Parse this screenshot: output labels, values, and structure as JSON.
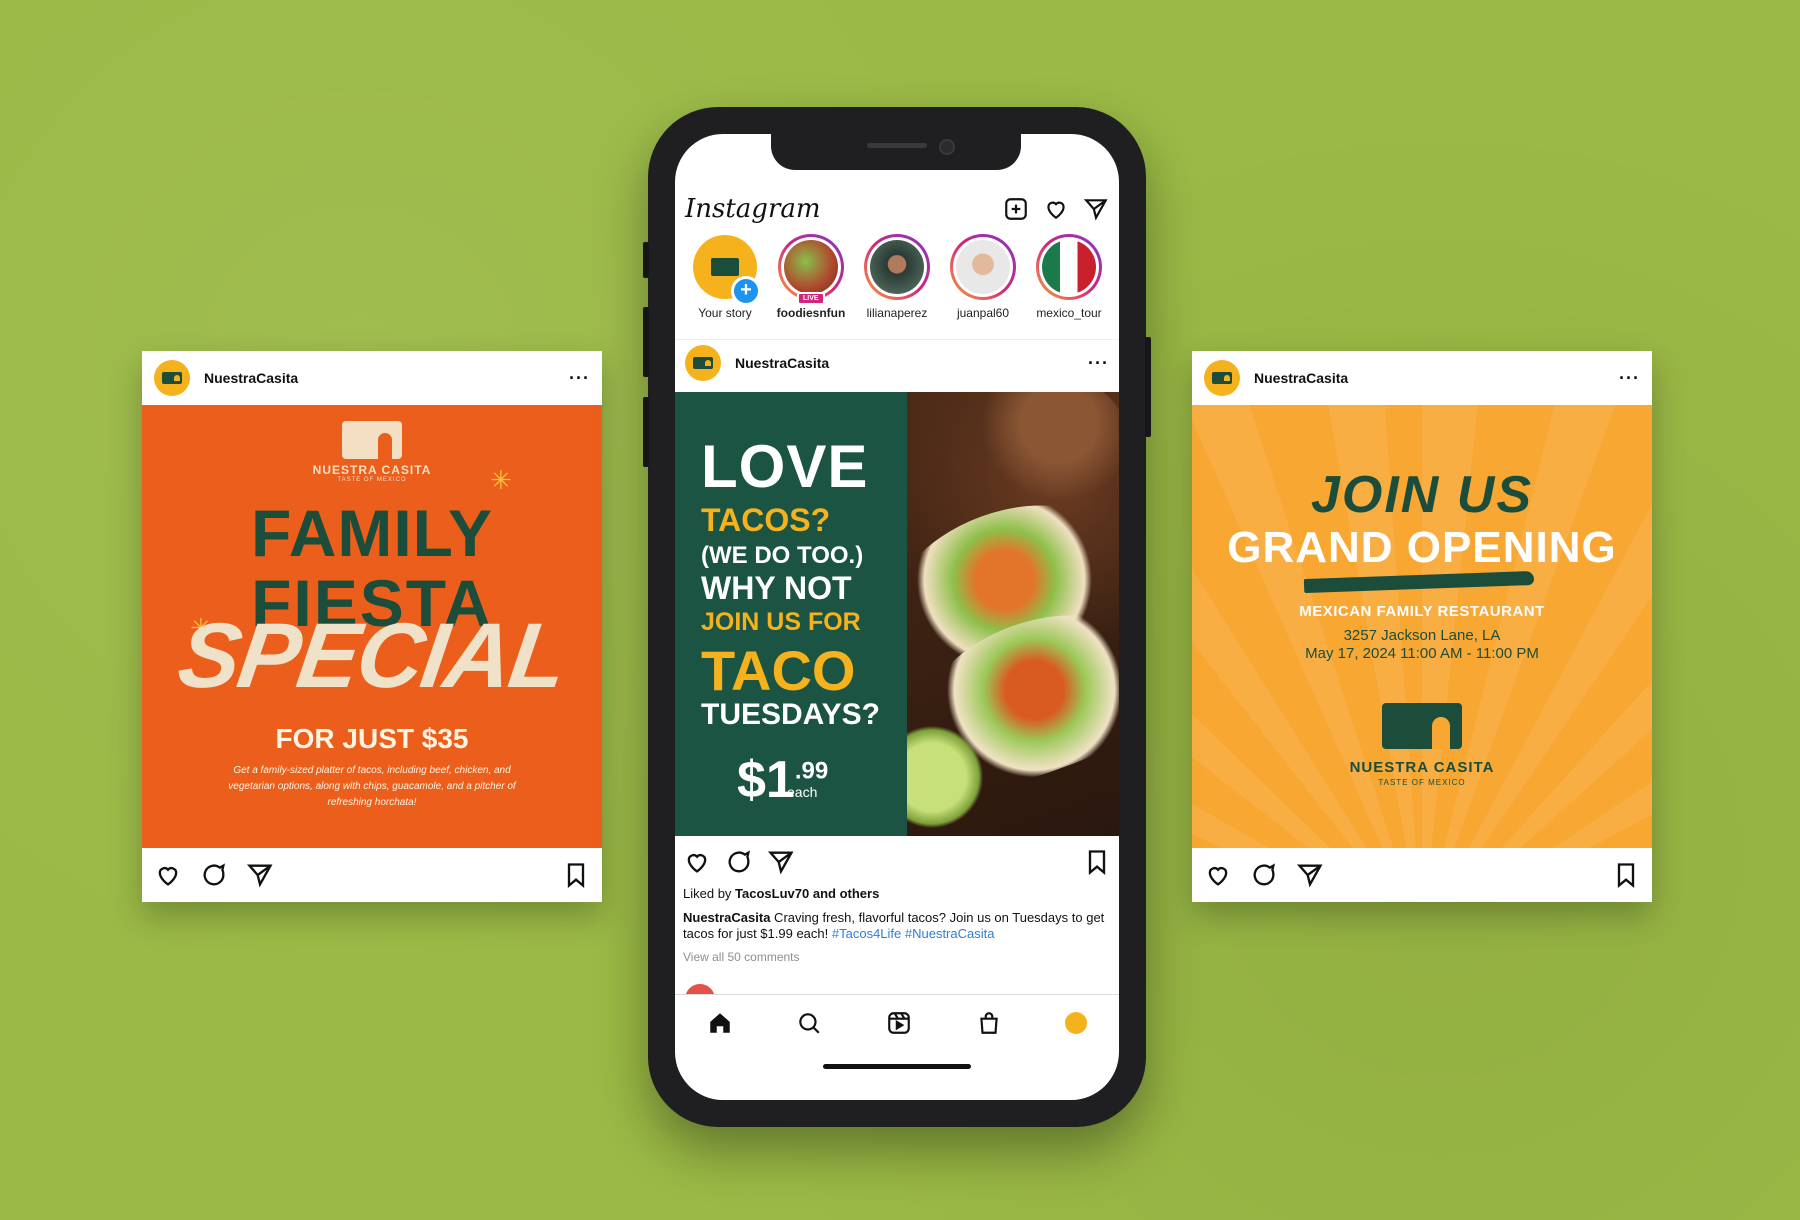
{
  "account": "NuestraCasita",
  "left_card": {
    "brand_name": "NUESTRA CASITA",
    "brand_tag": "TASTE OF MEXICO",
    "line1": "FAMILY",
    "line2": "FIESTA",
    "line3": "SPECIAL",
    "price_line": "FOR JUST $35",
    "description": "Get a family-sized platter of tacos, including beef, chicken, and vegetarian options, along with chips, guacamole, and a pitcher of refreshing horchata!"
  },
  "right_card": {
    "line1": "JOIN US",
    "line2": "GRAND OPENING",
    "line3": "MEXICAN FAMILY RESTAURANT",
    "address": "3257 Jackson Lane, LA",
    "datetime": "May 17, 2024 11:00 AM - 11:00 PM",
    "brand_name": "NUESTRA CASITA",
    "brand_tag": "TASTE OF MEXICO"
  },
  "phone": {
    "app_title": "Instagram",
    "stories": [
      {
        "label": "Your story",
        "own": true
      },
      {
        "label": "foodiesnfun",
        "live": true,
        "live_label": "LIVE"
      },
      {
        "label": "lilianaperez"
      },
      {
        "label": "juanpal60"
      },
      {
        "label": "mexico_tour"
      }
    ],
    "post": {
      "love": "LOVE",
      "tacos": "TACOS?",
      "wedo": "(WE DO TOO.)",
      "whynot": "WHY NOT",
      "joinus": "JOIN US FOR",
      "taco": "TACO",
      "tuesdays": "TUESDAYS?",
      "price": "$1",
      "price_cents": ".99",
      "each": "each",
      "liked_prefix": "Liked by ",
      "liked_user": "TacosLuv70",
      "liked_suffix": " and others",
      "caption_text": " Craving fresh, flavorful tacos? Join us on Tuesdays to get tacos for just $1.99 each!",
      "hashtags": " #Tacos4Life #NuestraCasita",
      "view_comments": "View all 50 comments"
    }
  },
  "colors": {
    "background": "#9ab945",
    "orange": "#ec5e1b",
    "yellow": "#f9a733",
    "green": "#1c5443"
  }
}
